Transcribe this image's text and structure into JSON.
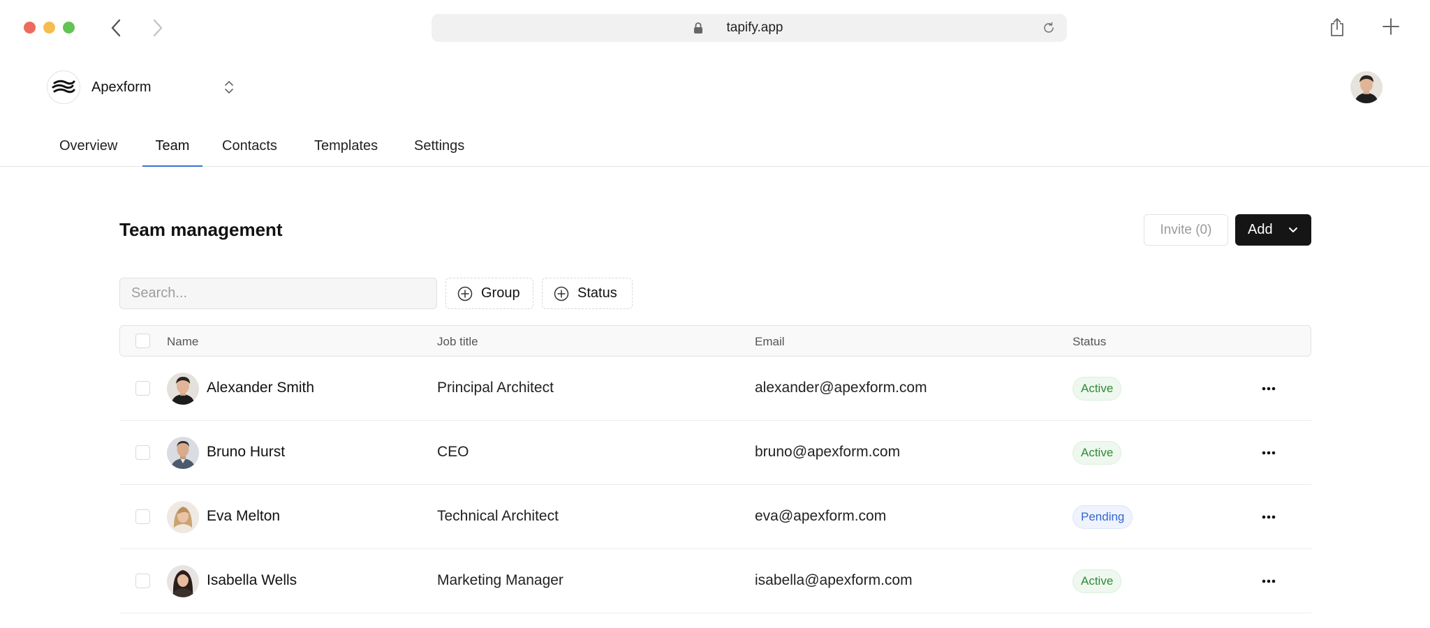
{
  "browser": {
    "url": "tapify.app"
  },
  "workspace": {
    "name": "Apexform"
  },
  "tabs": [
    {
      "label": "Overview",
      "active": false
    },
    {
      "label": "Team",
      "active": true
    },
    {
      "label": "Contacts",
      "active": false
    },
    {
      "label": "Templates",
      "active": false
    },
    {
      "label": "Settings",
      "active": false
    }
  ],
  "main": {
    "title": "Team management",
    "invite_label": "Invite (0)",
    "add_label": "Add",
    "search_placeholder": "Search...",
    "filters": [
      "Group",
      "Status"
    ]
  },
  "table": {
    "columns": [
      "Name",
      "Job title",
      "Email",
      "Status"
    ],
    "rows": [
      {
        "name": "Alexander Smith",
        "job": "Principal Architect",
        "email": "alexander@apexform.com",
        "status": "Active"
      },
      {
        "name": "Bruno Hurst",
        "job": "CEO",
        "email": "bruno@apexform.com",
        "status": "Active"
      },
      {
        "name": "Eva Melton",
        "job": "Technical Architect",
        "email": "eva@apexform.com",
        "status": "Pending"
      },
      {
        "name": "Isabella Wells",
        "job": "Marketing Manager",
        "email": "isabella@apexform.com",
        "status": "Active"
      }
    ]
  },
  "colors": {
    "accent": "#3b6fd8",
    "active_badge": "#2f8a38",
    "pending_badge": "#3467cf",
    "primary_button": "#151515"
  }
}
